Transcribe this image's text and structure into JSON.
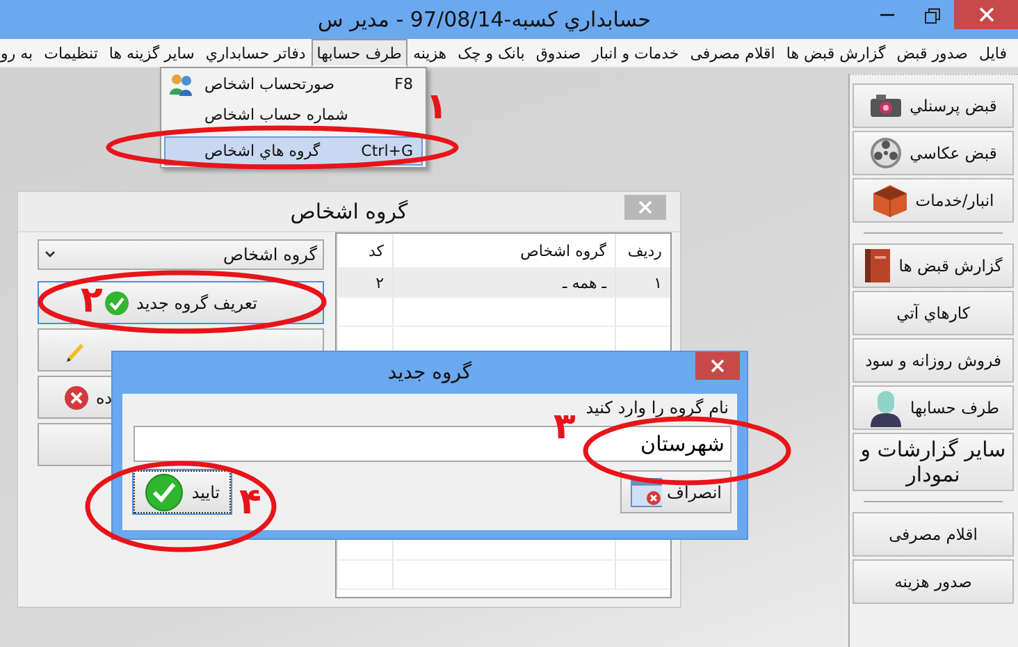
{
  "window": {
    "title": "حسابداري کسبه-97/08/14  -  مدير س"
  },
  "menu": [
    {
      "label": "فایل",
      "selected": false
    },
    {
      "label": "صدور قبض",
      "selected": false
    },
    {
      "label": "گزارش قبض ها",
      "selected": false
    },
    {
      "label": "اقلام مصرفی",
      "selected": false
    },
    {
      "label": "خدمات و انبار",
      "selected": false
    },
    {
      "label": "صندوق",
      "selected": false
    },
    {
      "label": "بانک و چک",
      "selected": false
    },
    {
      "label": "هزینه",
      "selected": false
    },
    {
      "label": "طرف حسابها",
      "selected": true
    },
    {
      "label": "دفاتر حسابداري",
      "selected": false
    },
    {
      "label": "سایر گزینه ها",
      "selected": false
    },
    {
      "label": "تنظیمات",
      "selected": false
    },
    {
      "label": "به رو",
      "selected": false
    }
  ],
  "dropdown": [
    {
      "label": "صورتحساب اشخاص",
      "shortcut": "F8",
      "selected": false
    },
    {
      "label": "شماره حساب اشخاص",
      "selected": false
    },
    {
      "label": "گروه هاي اشخاص",
      "shortcut": "Ctrl+G",
      "selected": true
    }
  ],
  "sidebar": [
    {
      "kind": "button",
      "label": "قبض پرسنلي"
    },
    {
      "kind": "button",
      "label": "قبض عکاسي"
    },
    {
      "kind": "button",
      "label": "انبار/خدمات"
    },
    {
      "kind": "separator"
    },
    {
      "kind": "button",
      "label": "گزارش قبض ها"
    },
    {
      "kind": "button",
      "label": "کارهاي آتي"
    },
    {
      "kind": "button",
      "label": "فروش روزانه و سود"
    },
    {
      "kind": "button",
      "label": "طرف حسابها"
    },
    {
      "kind": "big",
      "label": "سایر گزارشات و نمودار"
    },
    {
      "kind": "separator"
    },
    {
      "kind": "button",
      "label": "اقلام مصرفی"
    },
    {
      "kind": "button",
      "label": "صدور هزینه"
    }
  ],
  "groups_dialog": {
    "title": "گروه اشخاص",
    "combo": "گروه اشخاص",
    "buttons": [
      {
        "label": "تعریف گروه جدید",
        "focused": true
      },
      {
        "focused": false
      },
      {
        "label": "ده",
        "focused": false
      },
      {
        "focused": false
      }
    ],
    "table": {
      "columns": [
        "ردیف",
        "گروه اشخاص",
        "کد"
      ],
      "rows": [
        [
          "١",
          "ـ همه ـ",
          "٢"
        ]
      ]
    }
  },
  "new_group_dialog": {
    "title": "گروه جدید",
    "prompt": "نام گروه را وارد کنید",
    "value": "شهرستان",
    "cancel": "انصراف",
    "ok": "تایید"
  },
  "annotations": [
    "١",
    "٢",
    "٣",
    "۴"
  ]
}
